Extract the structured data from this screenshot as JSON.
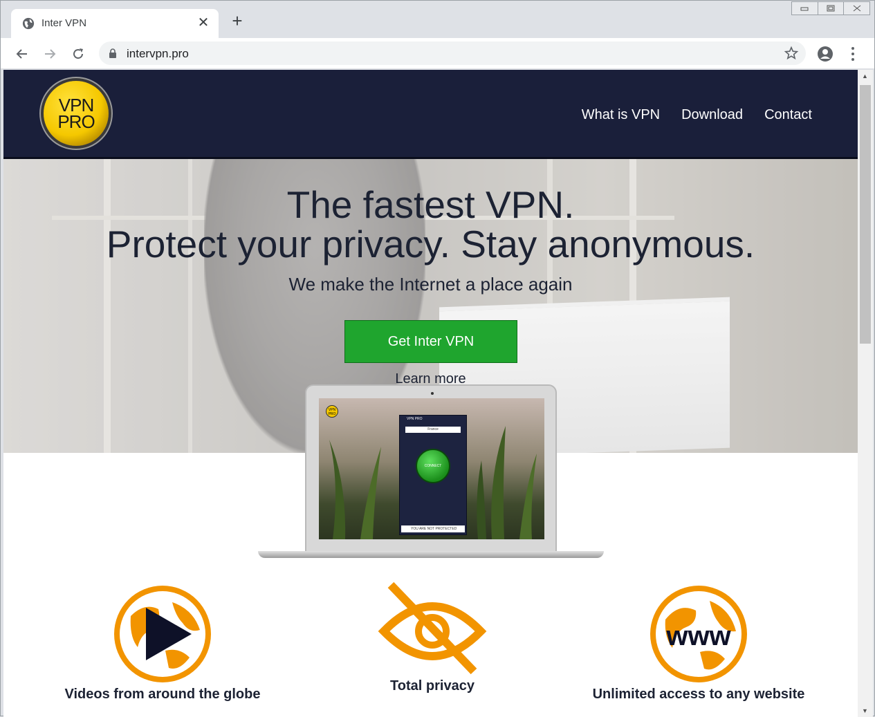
{
  "browser": {
    "tab_title": "Inter VPN",
    "url": "intervpn.pro"
  },
  "site": {
    "logo_line1": "VPN",
    "logo_line2": "PRO",
    "nav": [
      "What is VPN",
      "Download",
      "Contact"
    ]
  },
  "hero": {
    "headline1": "The fastest VPN.",
    "headline2": "Protect your privacy. Stay anonymous.",
    "subheadline": "We make the Internet a place again",
    "cta_label": "Get Inter VPN",
    "learn_more": "Learn more"
  },
  "app_preview": {
    "app_name": "VPN PRO",
    "country": "France",
    "connect_label": "CONNECT",
    "status": "YOU ARE NOT PROTECTED"
  },
  "features": [
    {
      "label": "Videos from around the globe",
      "icon": "globe-play-icon"
    },
    {
      "label": "Total privacy",
      "icon": "eye-slash-icon"
    },
    {
      "label": "Unlimited access to any website",
      "icon": "globe-www-icon"
    }
  ],
  "colors": {
    "header_bg": "#1a1f3a",
    "cta_green": "#1fa52e",
    "accent_orange": "#f29400"
  }
}
